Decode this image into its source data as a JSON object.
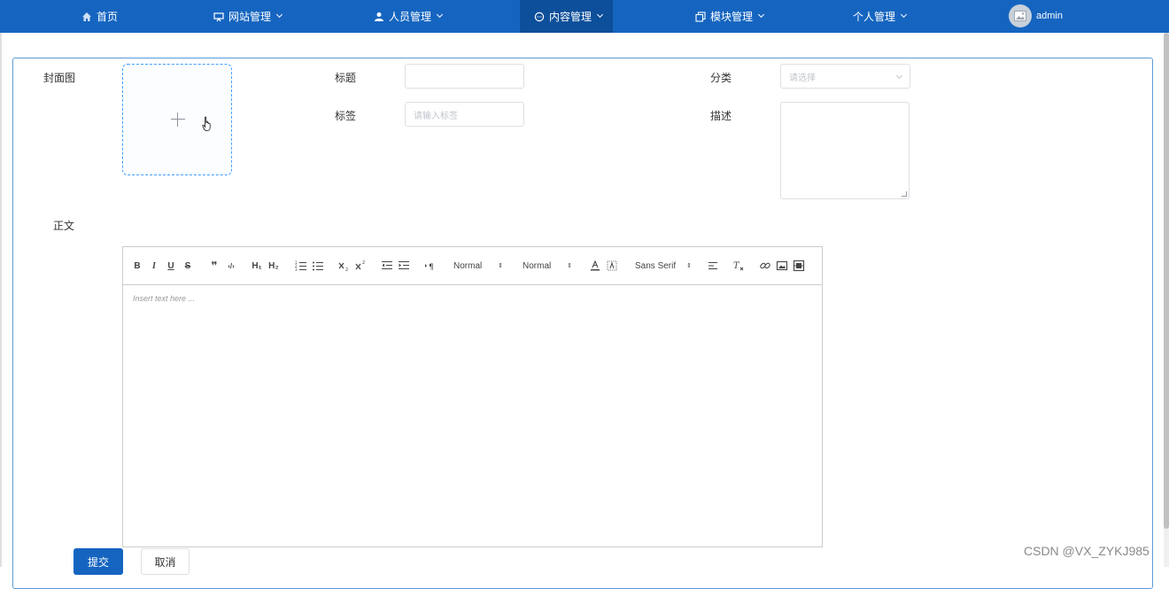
{
  "nav": {
    "home": "首页",
    "website_mgmt": "网站管理",
    "people_mgmt": "人员管理",
    "content_mgmt": "内容管理",
    "module_mgmt": "模块管理",
    "personal_mgmt": "个人管理",
    "user": "admin",
    "icons": [
      "home-icon",
      "monitor-icon",
      "user-icon",
      "chat-icon",
      "copy-icon",
      "chevron-down-icon"
    ]
  },
  "form": {
    "cover_label": "封面图",
    "title_label": "标题",
    "title_value": "",
    "category_label": "分类",
    "category_placeholder": "请选择",
    "tags_label": "标签",
    "tags_placeholder": "请输入标签",
    "desc_label": "描述",
    "body_label": "正文"
  },
  "editor": {
    "toolbar": {
      "bold": "B",
      "italic": "I",
      "underline": "U",
      "strike": "S",
      "blockquote": "❞",
      "code": "‹/›",
      "h1": "H₁",
      "h2": "H₂",
      "size_select": "Normal",
      "header_select": "Normal",
      "font_select": "Sans Serif",
      "updown": "⇕"
    },
    "placeholder": "Insert text here ..."
  },
  "actions": {
    "submit": "提交",
    "cancel": "取消"
  },
  "watermark": "CSDN @VX_ZYKJ985",
  "colors": {
    "nav_bg": "#1565c0",
    "nav_active_bg": "#0d4f9a",
    "primary": "#1565c0",
    "upload_border": "#409eff"
  }
}
